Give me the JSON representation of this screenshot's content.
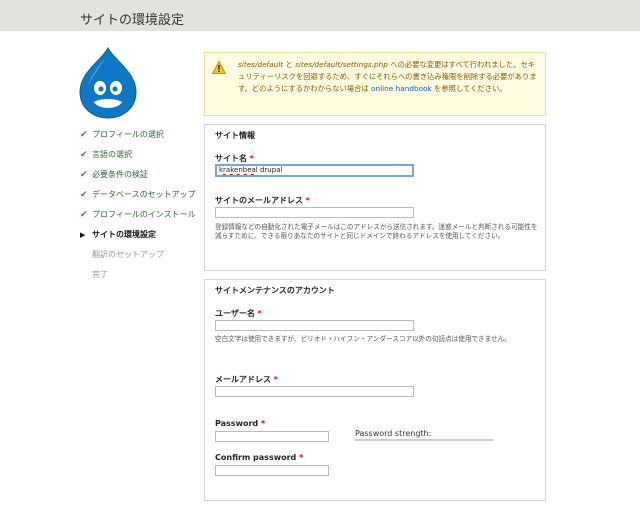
{
  "header": {
    "title": "サイトの環境設定"
  },
  "steps": [
    {
      "label": "プロフィールの選択",
      "status": "done"
    },
    {
      "label": "言語の選択",
      "status": "done"
    },
    {
      "label": "必要条件の検証",
      "status": "done"
    },
    {
      "label": "データベースのセットアップ",
      "status": "done"
    },
    {
      "label": "プロフィールのインストール",
      "status": "done"
    },
    {
      "label": "サイトの環境設定",
      "status": "active"
    },
    {
      "label": "翻訳のセットアップ",
      "status": "future"
    },
    {
      "label": "完了",
      "status": "future"
    }
  ],
  "warning": {
    "file1": "sites/default",
    "and": " と ",
    "file2": "sites/default/settings.php",
    "text1": " への必要な変更はすべて行われました。セキュリティーリスクを回避するため、すぐにそれらへの書き込み権限を削除する必要があります。どのようにするかわからない場合は ",
    "link": "online handbook",
    "text2": " を参照してください。",
    "icon": "warning-triangle-icon"
  },
  "site_info": {
    "legend": "サイト情報",
    "site_name_label": "サイト名",
    "site_name_value_misspelled": "krakenbeal",
    "site_name_value_rest": " drupal",
    "site_email_label": "サイトのメールアドレス",
    "site_email_value": "",
    "site_email_desc": "登録情報などの自動化された電子メールはこのアドレスから送信されます。迷惑メールと判断される可能性を減らすために、できる限りあなたのサイトと同じドメインで終わるアドレスを使用してください。"
  },
  "account": {
    "legend": "サイトメンテナンスのアカウント",
    "username_label": "ユーザー名",
    "username_desc": "空白文字は使用できますが、ピリオド・ハイフン・アンダースコア以外の句読点は使用できません。",
    "email_label": "メールアドレス",
    "password_label": "Password",
    "password_strength": "Password strength:",
    "confirm_label": "Confirm password"
  },
  "required_mark": "*",
  "colors": {
    "header_bg": "#e3e2dc",
    "done": "#2c6b2f",
    "drupal_blue": "#0f78c4",
    "required": "#d8001c"
  }
}
